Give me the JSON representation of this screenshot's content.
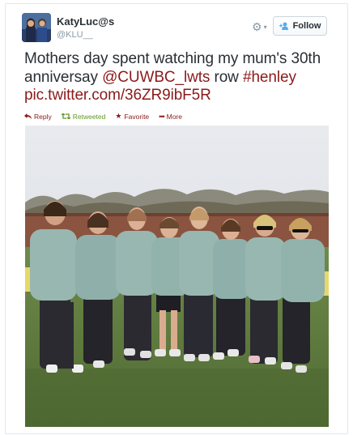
{
  "tweet": {
    "display_name": "KatyLuc@s",
    "handle": "@KLU__",
    "text_plain_1": "Mothers day spent watching my mum's 30th anniversay ",
    "mention": "@CUWBC_lwts",
    "text_plain_2": " row ",
    "hashtag": "#henley",
    "media_link": "pic.twitter.com/36ZR9ibF5R"
  },
  "header": {
    "follow_label": "Follow",
    "gear_icon": "gear-icon",
    "follow_icon": "add-user-icon"
  },
  "actions": {
    "reply_label": "Reply",
    "retweet_label": "Retweeted",
    "favorite_label": "Favorite",
    "more_label": "More"
  },
  "colors": {
    "link": "#8b1a1a",
    "retweeted": "#609928",
    "follow_icon": "#55acee"
  }
}
